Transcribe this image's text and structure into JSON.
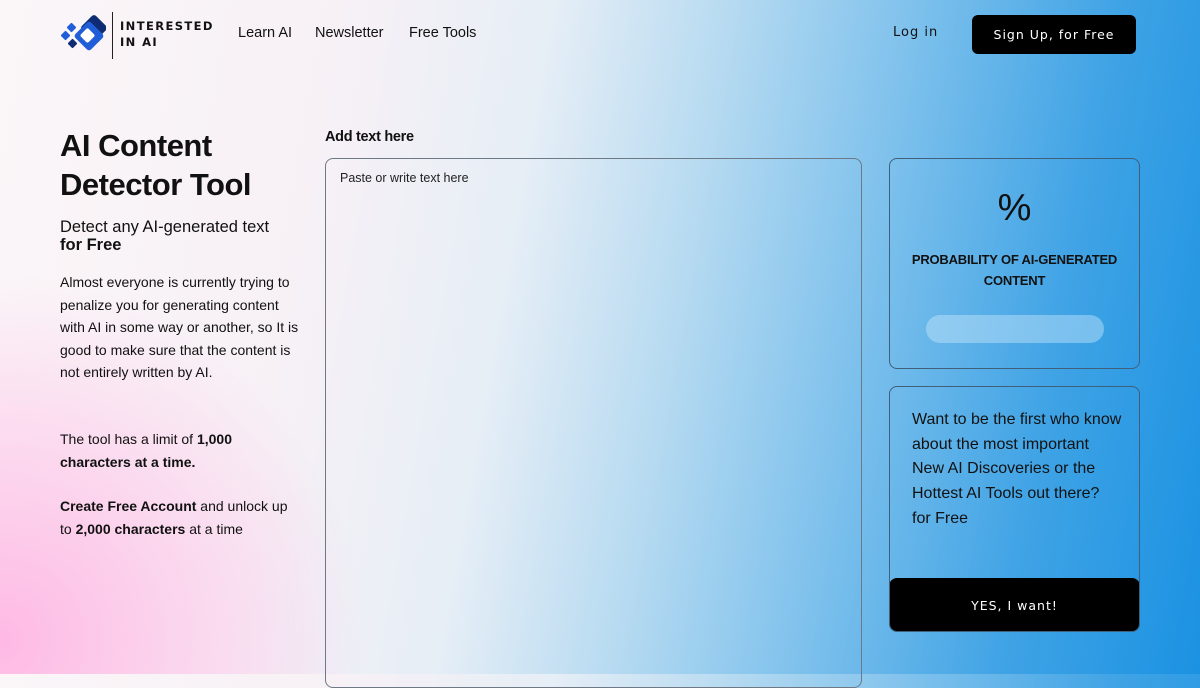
{
  "brand": {
    "name_line1": "INTERESTED",
    "name_line2": "IN AI",
    "logo_icon": "diamond-logo-icon"
  },
  "nav": {
    "links": [
      "Learn AI",
      "Newsletter",
      "Free Tools"
    ],
    "login": "Log in",
    "signup": "Sign Up, for Free"
  },
  "hero": {
    "title_line1": "AI Content",
    "title_line2": "Detector Tool",
    "subtitle": "Detect any AI-generated text",
    "subtitle_bold": "for Free",
    "intro": "Almost everyone is currently trying to penalize you for generating content with AI in some way or another, so It is good to make sure that the content is not entirely written by AI.",
    "limit_prefix": "The tool has a limit of ",
    "limit_bold": "1,000 characters at a time.",
    "cta_bold": "Create Free Account",
    "cta_mid": " and unlock up to ",
    "cta_bold2": "2,000 characters",
    "cta_suffix": " at a time"
  },
  "editor": {
    "label": "Add text here",
    "placeholder": "Paste or write text here",
    "value": ""
  },
  "result": {
    "percent": "%",
    "label": "PROBABILITY OF AI-GENERATED CONTENT",
    "progress_fraction": 0
  },
  "newsletter": {
    "text": "Want to be the first who know about the most important New AI Discoveries or the Hottest AI Tools out there? for Free",
    "button": "YES, I want!"
  },
  "colors": {
    "accent_button": "#000000",
    "logo_blue": "#1f5ed6",
    "logo_dark": "#0e2b74",
    "progress_track": "#c8e6fa"
  }
}
